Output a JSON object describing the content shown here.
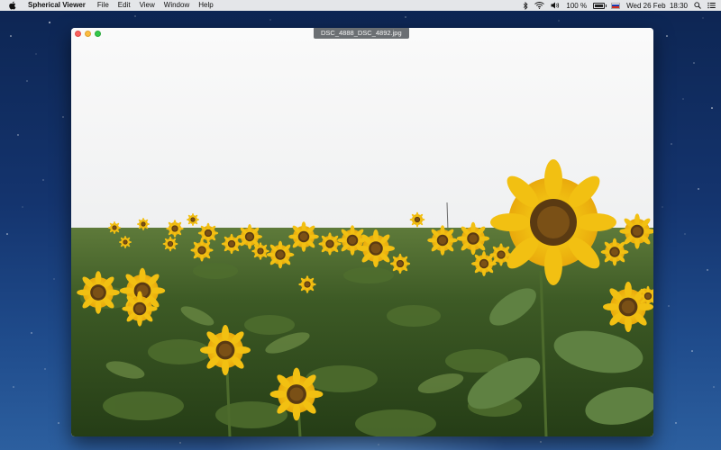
{
  "menubar": {
    "apple_icon": "apple-logo-icon",
    "app_name": "Spherical Viewer",
    "menus": [
      "File",
      "Edit",
      "View",
      "Window",
      "Help"
    ],
    "status": {
      "bluetooth_icon": "bluetooth-icon",
      "wifi_icon": "wifi-icon",
      "volume_icon": "volume-icon",
      "battery_text": "100 %",
      "battery_level": 1.0,
      "flag_icon": "russian-flag-icon",
      "clock": "Wed 26 Feb  18:30",
      "search_icon": "spotlight-search-icon",
      "notification_icon": "notification-center-icon"
    }
  },
  "window": {
    "title": "DSC_4888_DSC_4892.jpg",
    "image_subject": "sunflower-field-photo"
  },
  "colors": {
    "menubar_bg": "#f2f2f2",
    "close": "#fc615d",
    "minimize": "#fdbc40",
    "zoom": "#34c84a",
    "title_pill": "#6b6f73"
  }
}
